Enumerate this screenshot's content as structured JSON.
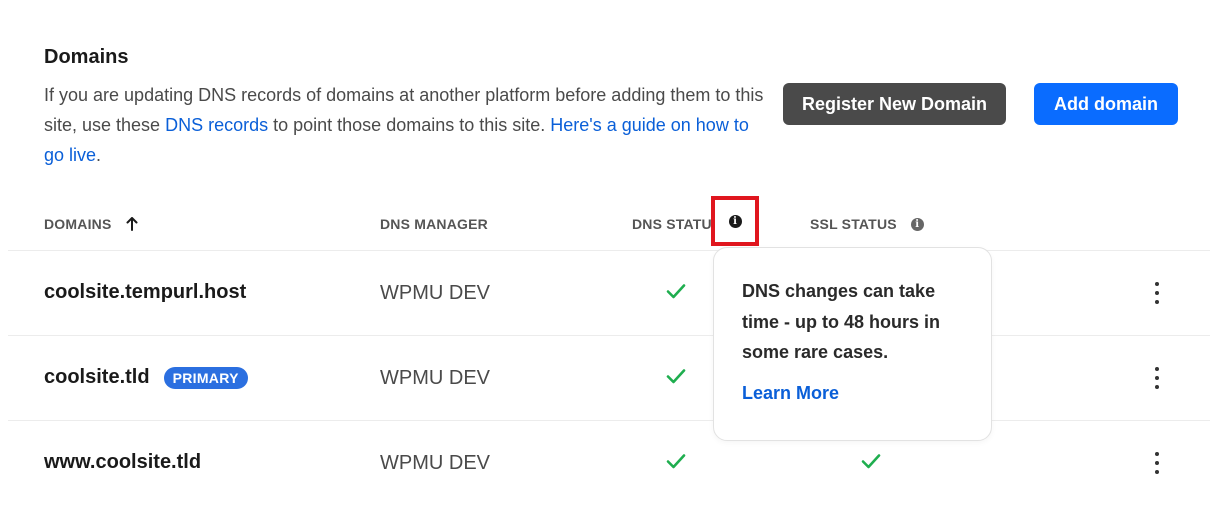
{
  "section": {
    "title": "Domains",
    "desc_part1": "If you are updating DNS records of domains at another platform before adding them to this site, use these ",
    "desc_link1": "DNS records",
    "desc_part2": " to point those domains to this site. ",
    "desc_link2": "Here's a guide on how to go live",
    "desc_end": "."
  },
  "buttons": {
    "register": "Register New Domain",
    "add": "Add domain"
  },
  "table": {
    "headers": {
      "domains": "DOMAINS",
      "dns_manager": "DNS MANAGER",
      "dns_status": "DNS STATUS",
      "ssl_status": "SSL STATUS"
    },
    "rows": [
      {
        "domain": "coolsite.tempurl.host",
        "badge": "",
        "dns_manager": "WPMU DEV",
        "dns_ok": true,
        "ssl_ok": true
      },
      {
        "domain": "coolsite.tld",
        "badge": "PRIMARY",
        "dns_manager": "WPMU DEV",
        "dns_ok": true,
        "ssl_ok": true
      },
      {
        "domain": "www.coolsite.tld",
        "badge": "",
        "dns_manager": "WPMU DEV",
        "dns_ok": true,
        "ssl_ok": true
      }
    ]
  },
  "tooltip": {
    "text": "DNS changes can take time - up to 48 hours in some rare cases.",
    "link": "Learn More"
  },
  "colors": {
    "accent": "#0a6cff",
    "link": "#0a5fd8",
    "check": "#1fae4f",
    "highlight": "#e0161e",
    "badge": "#2b6fe0"
  },
  "icons": {
    "sort": "arrow-up-icon",
    "info": "info-icon",
    "status": "check-icon",
    "menu": "kebab-menu-icon"
  }
}
